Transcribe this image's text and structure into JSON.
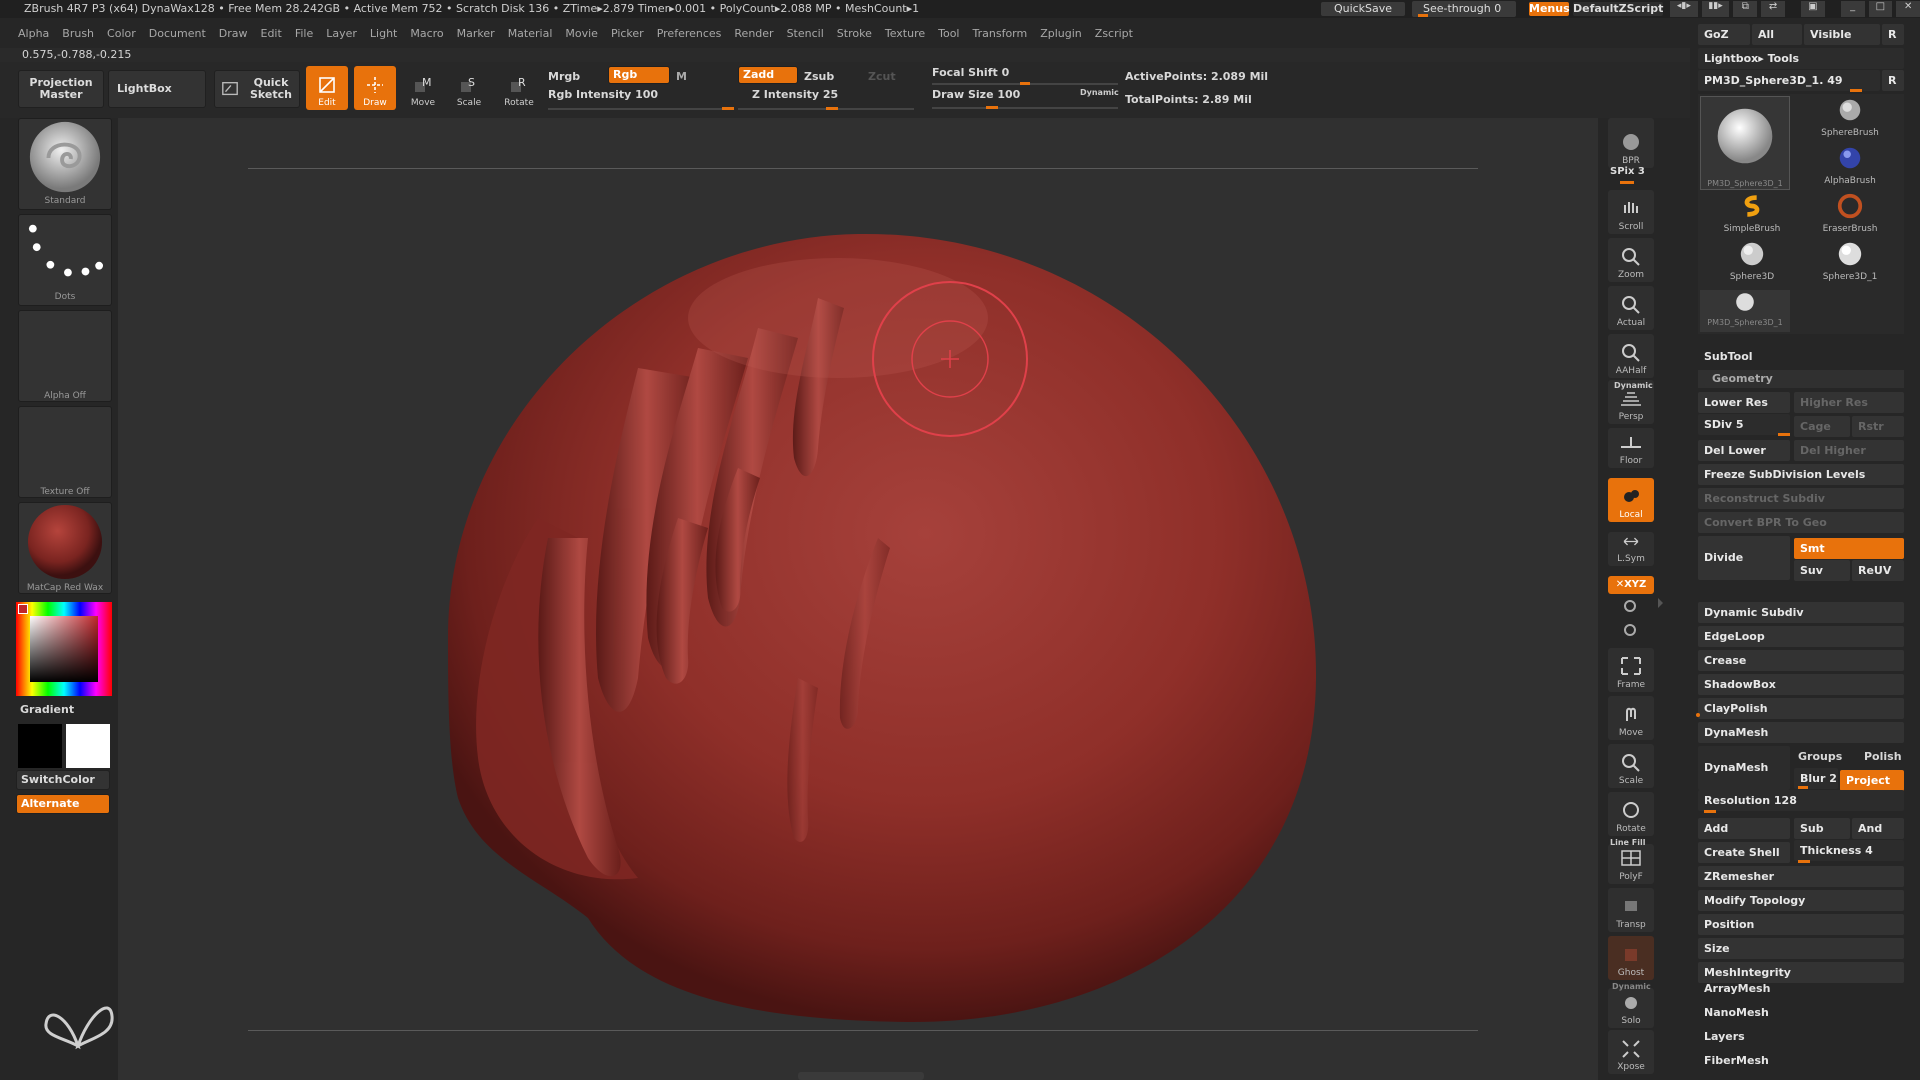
{
  "titlebar": {
    "text": "ZBrush 4R7 P3 (x64)   DynaWax128   • Free Mem 28.242GB • Active Mem 752 • Scratch Disk 136 • ZTime▸2.879 Timer▸0.001 • PolyCount▸2.088 MP • MeshCount▸1",
    "quicksave": "QuickSave",
    "see_through": "See-through  0",
    "menus": "Menus",
    "script": "DefaultZScript"
  },
  "menubar": {
    "items": [
      "Alpha",
      "Brush",
      "Color",
      "Document",
      "Draw",
      "Edit",
      "File",
      "Layer",
      "Light",
      "Macro",
      "Marker",
      "Material",
      "Movie",
      "Picker",
      "Preferences",
      "Render",
      "Stencil",
      "Stroke",
      "Texture",
      "Tool",
      "Transform",
      "Zplugin",
      "Zscript"
    ]
  },
  "coords": "0.575,-0.788,-0.215",
  "toolbar": {
    "projection_master": "Projection Master",
    "lightbox": "LightBox",
    "quick_sketch": "Quick Sketch",
    "edit": "Edit",
    "draw": "Draw",
    "move": "Move",
    "scale": "Scale",
    "rotate": "Rotate",
    "mrgb": "Mrgb",
    "rgb": "Rgb",
    "m": "M",
    "rgb_intensity": "Rgb Intensity 100",
    "zadd": "Zadd",
    "zsub": "Zsub",
    "zcut": "Zcut",
    "z_intensity": "Z Intensity 25",
    "focal_shift": "Focal Shift 0",
    "draw_size": "Draw Size 100",
    "dynamic": "Dynamic",
    "active_points": "ActivePoints: 2.089 Mil",
    "total_points": "TotalPoints: 2.89 Mil",
    "rgb_intensity_value": 100,
    "z_intensity_value": 25,
    "focal_shift_value": 0,
    "draw_size_value": 100
  },
  "leftshelf": {
    "brush": "Standard",
    "stroke": "Dots",
    "alpha": "Alpha Off",
    "texture": "Texture Off",
    "material": "MatCap Red Wax",
    "gradient": "Gradient",
    "switchcolor": "SwitchColor",
    "alternate": "Alternate"
  },
  "rightshelf": {
    "bpr": "BPR",
    "spix": "SPix 3",
    "scroll": "Scroll",
    "zoom": "Zoom",
    "actual": "Actual",
    "aahalf": "AAHalf",
    "dynamic": "Dynamic",
    "persp": "Persp",
    "floor": "Floor",
    "local": "Local",
    "lsym": "L.Sym",
    "xyz": "✕XYZ",
    "frame": "Frame",
    "move": "Move",
    "scale": "Scale",
    "rotate": "Rotate",
    "linefill": "Line Fill",
    "polyf": "PolyF",
    "transp": "Transp",
    "ghost": "Ghost",
    "dynamic2": "Dynamic",
    "solo": "Solo",
    "xpose": "Xpose"
  },
  "rightpanel": {
    "goz": "GoZ",
    "all": "All",
    "visible": "Visible",
    "r": "R",
    "lightbox_tools": "Lightbox▸ Tools",
    "tool_name": "PM3D_Sphere3D_1. 49",
    "tools": [
      {
        "label": "SphereBrush"
      },
      {
        "label": "AlphaBrush"
      },
      {
        "label": "SimpleBrush"
      },
      {
        "label": "EraserBrush"
      },
      {
        "label": "Sphere3D"
      },
      {
        "label": "Sphere3D_1"
      }
    ],
    "big_tool": "PM3D_Sphere3D_1",
    "small_tool": "PM3D_Sphere3D_1",
    "subtool": "SubTool",
    "geometry": "Geometry",
    "lower_res": "Lower Res",
    "higher_res": "Higher Res",
    "sdiv": "SDiv 5",
    "cage": "Cage",
    "rstr": "Rstr",
    "del_lower": "Del Lower",
    "del_higher": "Del Higher",
    "freeze": "Freeze SubDivision Levels",
    "reconstruct": "Reconstruct Subdiv",
    "convert_bpr": "Convert BPR To Geo",
    "divide": "Divide",
    "smt": "Smt",
    "suv": "Suv",
    "reuv": "ReUV",
    "dynamic_subdiv": "Dynamic Subdiv",
    "edgeloop": "EdgeLoop",
    "crease": "Crease",
    "shadowbox": "ShadowBox",
    "claypolish": "ClayPolish",
    "dynamesh_header": "DynaMesh",
    "dynamesh": "DynaMesh",
    "groups": "Groups",
    "polish": "Polish",
    "blur": "Blur 2",
    "project": "Project",
    "resolution": "Resolution 128",
    "add": "Add",
    "sub": "Sub",
    "and": "And",
    "create_shell": "Create Shell",
    "thickness": "Thickness 4",
    "zremesher": "ZRemesher",
    "modify_topology": "Modify Topology",
    "position": "Position",
    "size": "Size",
    "meshintegrity": "MeshIntegrity",
    "arraymesh": "ArrayMesh",
    "nanomesh": "NanoMesh",
    "layers": "Layers",
    "fibermesh": "FiberMesh"
  },
  "colors": {
    "accent": "#e8720c",
    "wax": "#8f2b26"
  }
}
